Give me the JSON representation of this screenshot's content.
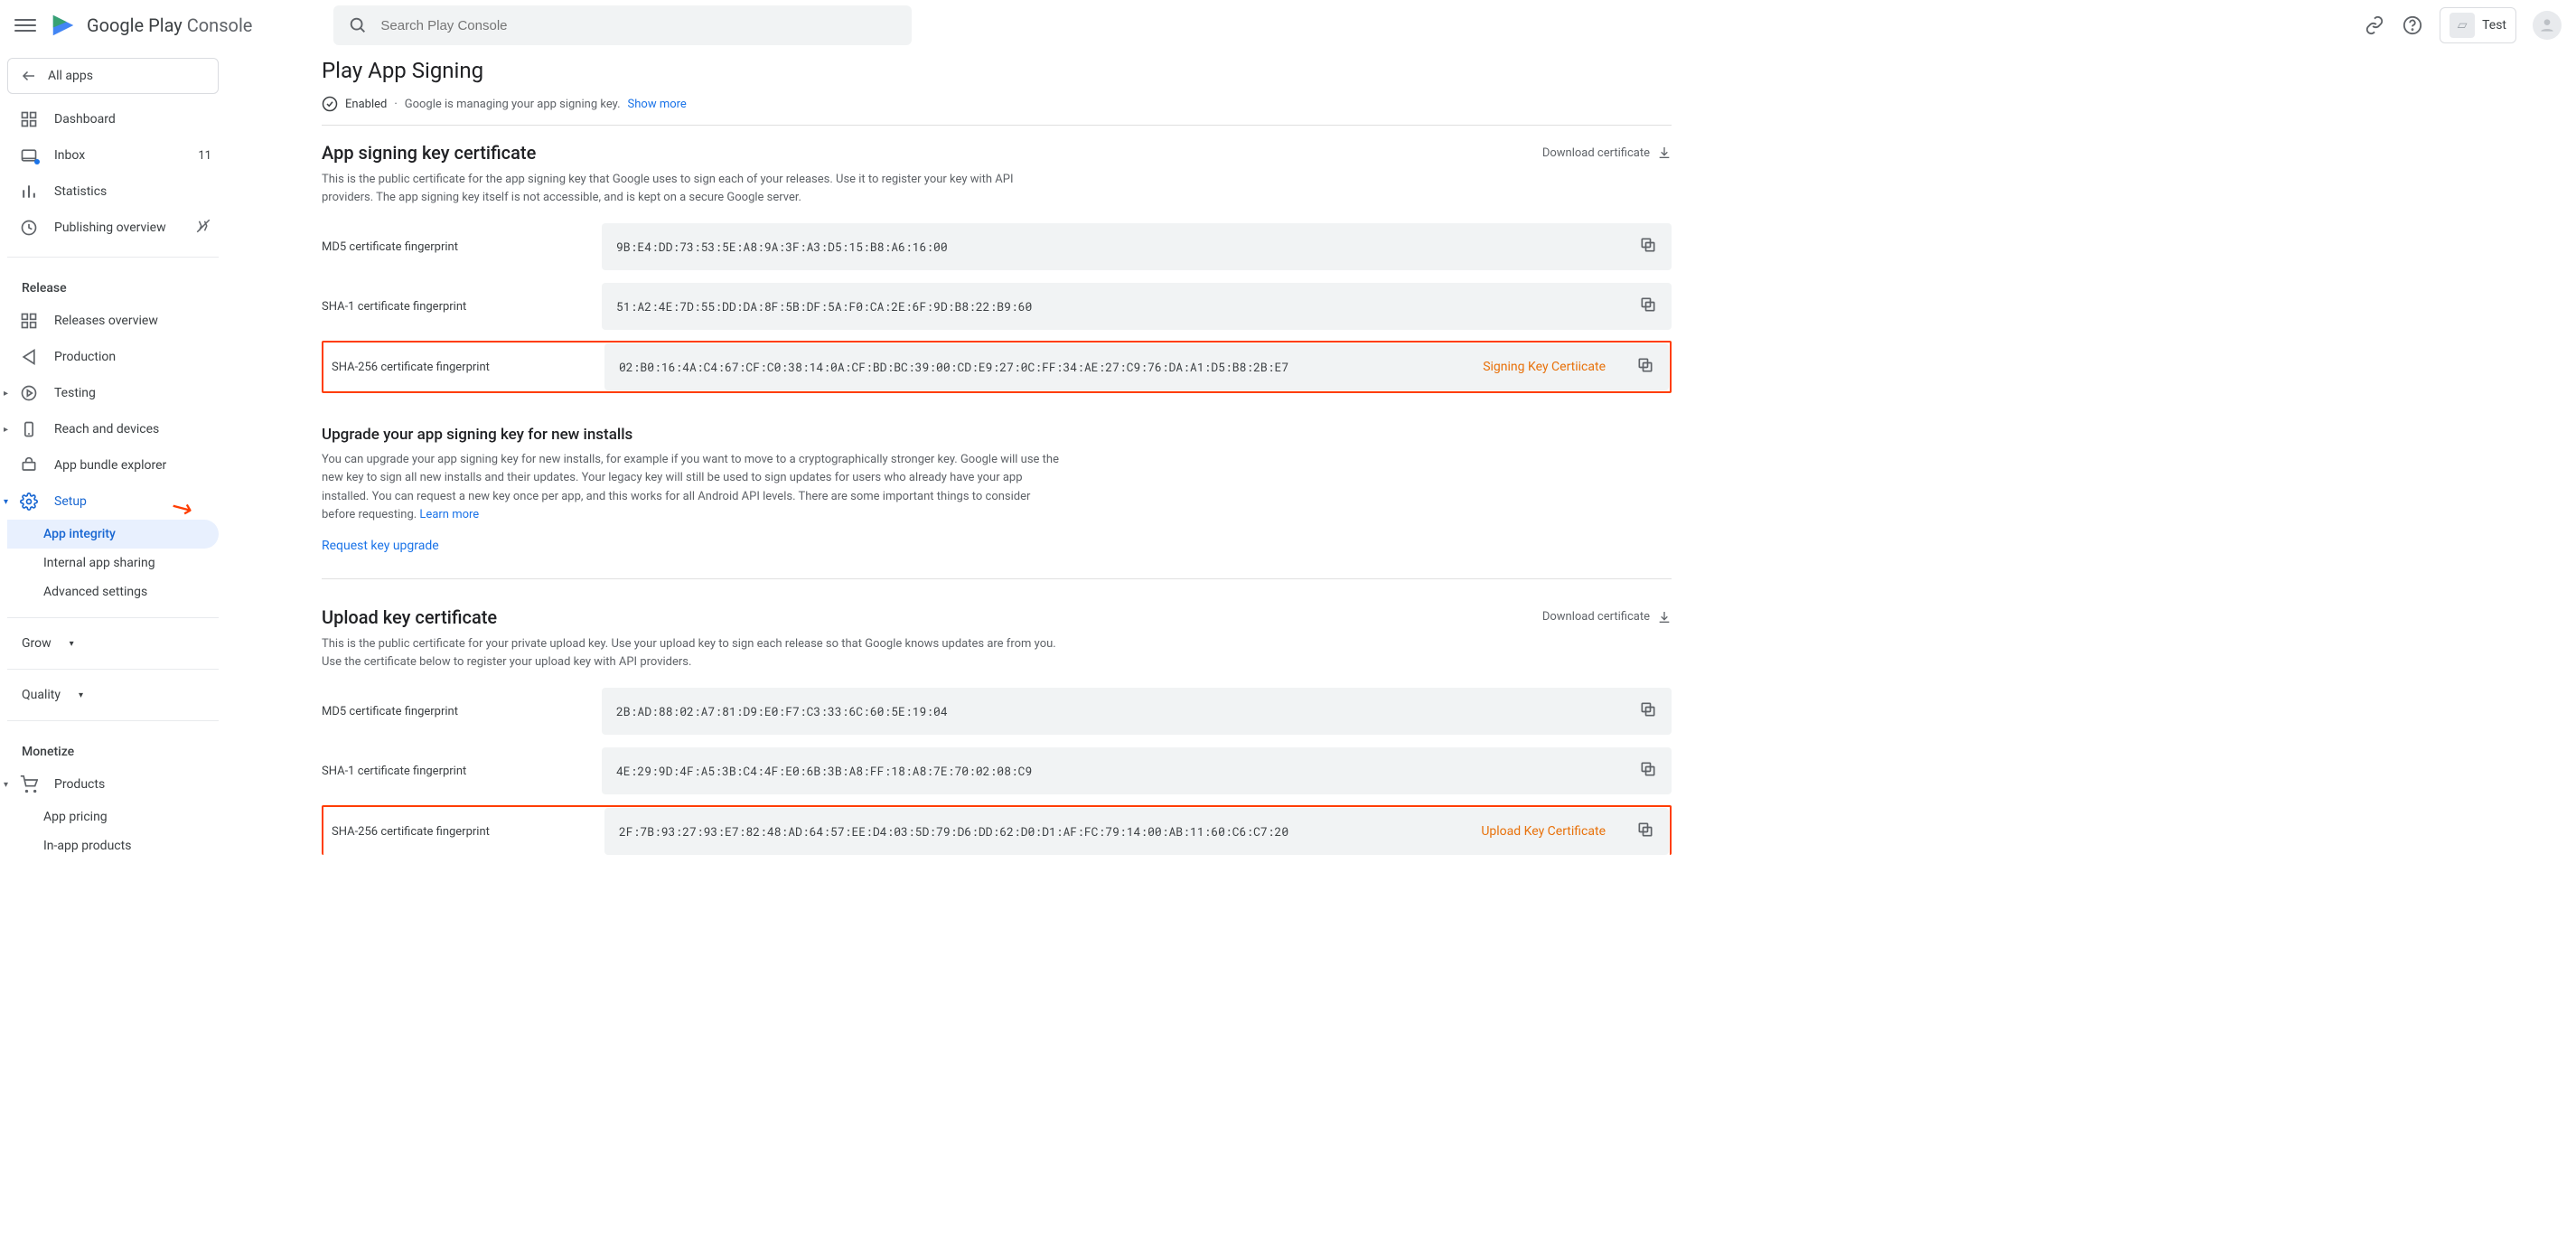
{
  "header": {
    "brand_g": "Google Play",
    "brand_rest": " Console",
    "search_placeholder": "Search Play Console",
    "app_name": "Test"
  },
  "sidebar": {
    "all_apps": "All apps",
    "items": {
      "dashboard": "Dashboard",
      "inbox": "Inbox",
      "inbox_count": "11",
      "statistics": "Statistics",
      "publishing_overview": "Publishing overview"
    },
    "release_label": "Release",
    "release": {
      "overview": "Releases overview",
      "production": "Production",
      "testing": "Testing",
      "reach": "Reach and devices",
      "bundle": "App bundle explorer",
      "setup": "Setup",
      "app_integrity": "App integrity",
      "internal_sharing": "Internal app sharing",
      "advanced": "Advanced settings"
    },
    "grow_label": "Grow",
    "quality_label": "Quality",
    "monetize_label": "Monetize",
    "monetize": {
      "products": "Products",
      "app_pricing": "App pricing",
      "in_app": "In-app products"
    }
  },
  "page": {
    "title": "Play App Signing",
    "status_enabled": "Enabled",
    "status_desc": "Google is managing your app signing key.",
    "show_more": "Show more"
  },
  "signing": {
    "title": "App signing key certificate",
    "desc": "This is the public certificate for the app signing key that Google uses to sign each of your releases. Use it to register your key with API providers. The app signing key itself is not accessible, and is kept on a secure Google server.",
    "download": "Download certificate",
    "md5_label": "MD5 certificate fingerprint",
    "md5_val": "9B:E4:DD:73:53:5E:A8:9A:3F:A3:D5:15:B8:A6:16:00",
    "sha1_label": "SHA-1 certificate fingerprint",
    "sha1_val": "51:A2:4E:7D:55:DD:DA:8F:5B:DF:5A:F0:CA:2E:6F:9D:B8:22:B9:60",
    "sha256_label": "SHA-256 certificate fingerprint",
    "sha256_val": "02:B0:16:4A:C4:67:CF:C0:38:14:0A:CF:BD:BC:39:00:CD:E9:27:0C:FF:34:AE:27:C9:76:DA:A1:D5:B8:2B:E7",
    "annotation": "Signing Key Certiicate"
  },
  "upgrade": {
    "title": "Upgrade your app signing key for new installs",
    "desc": "You can upgrade your app signing key for new installs, for example if you want to move to a cryptographically stronger key. Google will use the new key to sign all new installs and their updates. Your legacy key will still be used to sign updates for users who already have your app installed. You can request a new key once per app, and this works for all Android API levels. There are some important things to consider before requesting.",
    "learn_more": "Learn more",
    "request": "Request key upgrade"
  },
  "upload": {
    "title": "Upload key certificate",
    "desc": "This is the public certificate for your private upload key. Use your upload key to sign each release so that Google knows updates are from you. Use the certificate below to register your upload key with API providers.",
    "download": "Download certificate",
    "md5_label": "MD5 certificate fingerprint",
    "md5_val": "2B:AD:88:02:A7:81:D9:E0:F7:C3:33:6C:60:5E:19:04",
    "sha1_label": "SHA-1 certificate fingerprint",
    "sha1_val": "4E:29:9D:4F:A5:3B:C4:4F:E0:6B:3B:A8:FF:18:A8:7E:70:02:08:C9",
    "sha256_label": "SHA-256 certificate fingerprint",
    "sha256_val": "2F:7B:93:27:93:E7:82:48:AD:64:57:EE:D4:03:5D:79:D6:DD:62:D0:D1:AF:FC:79:14:00:AB:11:60:C6:C7:20",
    "annotation": "Upload Key Certificate"
  }
}
